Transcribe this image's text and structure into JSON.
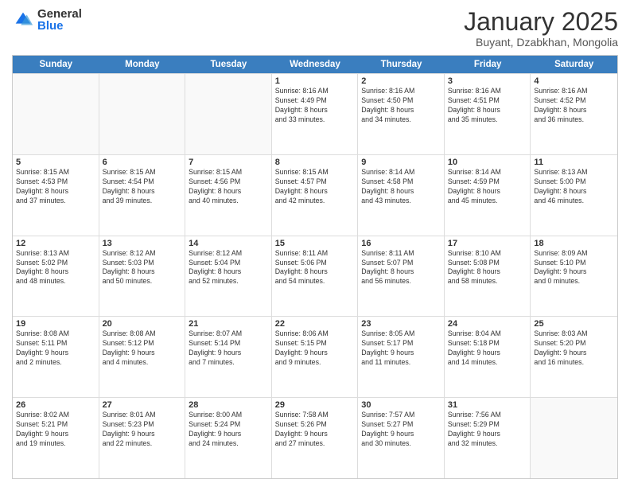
{
  "logo": {
    "general": "General",
    "blue": "Blue"
  },
  "header": {
    "month": "January 2025",
    "location": "Buyant, Dzabkhan, Mongolia"
  },
  "weekdays": [
    "Sunday",
    "Monday",
    "Tuesday",
    "Wednesday",
    "Thursday",
    "Friday",
    "Saturday"
  ],
  "rows": [
    [
      {
        "day": "",
        "text": ""
      },
      {
        "day": "",
        "text": ""
      },
      {
        "day": "",
        "text": ""
      },
      {
        "day": "1",
        "text": "Sunrise: 8:16 AM\nSunset: 4:49 PM\nDaylight: 8 hours\nand 33 minutes."
      },
      {
        "day": "2",
        "text": "Sunrise: 8:16 AM\nSunset: 4:50 PM\nDaylight: 8 hours\nand 34 minutes."
      },
      {
        "day": "3",
        "text": "Sunrise: 8:16 AM\nSunset: 4:51 PM\nDaylight: 8 hours\nand 35 minutes."
      },
      {
        "day": "4",
        "text": "Sunrise: 8:16 AM\nSunset: 4:52 PM\nDaylight: 8 hours\nand 36 minutes."
      }
    ],
    [
      {
        "day": "5",
        "text": "Sunrise: 8:15 AM\nSunset: 4:53 PM\nDaylight: 8 hours\nand 37 minutes."
      },
      {
        "day": "6",
        "text": "Sunrise: 8:15 AM\nSunset: 4:54 PM\nDaylight: 8 hours\nand 39 minutes."
      },
      {
        "day": "7",
        "text": "Sunrise: 8:15 AM\nSunset: 4:56 PM\nDaylight: 8 hours\nand 40 minutes."
      },
      {
        "day": "8",
        "text": "Sunrise: 8:15 AM\nSunset: 4:57 PM\nDaylight: 8 hours\nand 42 minutes."
      },
      {
        "day": "9",
        "text": "Sunrise: 8:14 AM\nSunset: 4:58 PM\nDaylight: 8 hours\nand 43 minutes."
      },
      {
        "day": "10",
        "text": "Sunrise: 8:14 AM\nSunset: 4:59 PM\nDaylight: 8 hours\nand 45 minutes."
      },
      {
        "day": "11",
        "text": "Sunrise: 8:13 AM\nSunset: 5:00 PM\nDaylight: 8 hours\nand 46 minutes."
      }
    ],
    [
      {
        "day": "12",
        "text": "Sunrise: 8:13 AM\nSunset: 5:02 PM\nDaylight: 8 hours\nand 48 minutes."
      },
      {
        "day": "13",
        "text": "Sunrise: 8:12 AM\nSunset: 5:03 PM\nDaylight: 8 hours\nand 50 minutes."
      },
      {
        "day": "14",
        "text": "Sunrise: 8:12 AM\nSunset: 5:04 PM\nDaylight: 8 hours\nand 52 minutes."
      },
      {
        "day": "15",
        "text": "Sunrise: 8:11 AM\nSunset: 5:06 PM\nDaylight: 8 hours\nand 54 minutes."
      },
      {
        "day": "16",
        "text": "Sunrise: 8:11 AM\nSunset: 5:07 PM\nDaylight: 8 hours\nand 56 minutes."
      },
      {
        "day": "17",
        "text": "Sunrise: 8:10 AM\nSunset: 5:08 PM\nDaylight: 8 hours\nand 58 minutes."
      },
      {
        "day": "18",
        "text": "Sunrise: 8:09 AM\nSunset: 5:10 PM\nDaylight: 9 hours\nand 0 minutes."
      }
    ],
    [
      {
        "day": "19",
        "text": "Sunrise: 8:08 AM\nSunset: 5:11 PM\nDaylight: 9 hours\nand 2 minutes."
      },
      {
        "day": "20",
        "text": "Sunrise: 8:08 AM\nSunset: 5:12 PM\nDaylight: 9 hours\nand 4 minutes."
      },
      {
        "day": "21",
        "text": "Sunrise: 8:07 AM\nSunset: 5:14 PM\nDaylight: 9 hours\nand 7 minutes."
      },
      {
        "day": "22",
        "text": "Sunrise: 8:06 AM\nSunset: 5:15 PM\nDaylight: 9 hours\nand 9 minutes."
      },
      {
        "day": "23",
        "text": "Sunrise: 8:05 AM\nSunset: 5:17 PM\nDaylight: 9 hours\nand 11 minutes."
      },
      {
        "day": "24",
        "text": "Sunrise: 8:04 AM\nSunset: 5:18 PM\nDaylight: 9 hours\nand 14 minutes."
      },
      {
        "day": "25",
        "text": "Sunrise: 8:03 AM\nSunset: 5:20 PM\nDaylight: 9 hours\nand 16 minutes."
      }
    ],
    [
      {
        "day": "26",
        "text": "Sunrise: 8:02 AM\nSunset: 5:21 PM\nDaylight: 9 hours\nand 19 minutes."
      },
      {
        "day": "27",
        "text": "Sunrise: 8:01 AM\nSunset: 5:23 PM\nDaylight: 9 hours\nand 22 minutes."
      },
      {
        "day": "28",
        "text": "Sunrise: 8:00 AM\nSunset: 5:24 PM\nDaylight: 9 hours\nand 24 minutes."
      },
      {
        "day": "29",
        "text": "Sunrise: 7:58 AM\nSunset: 5:26 PM\nDaylight: 9 hours\nand 27 minutes."
      },
      {
        "day": "30",
        "text": "Sunrise: 7:57 AM\nSunset: 5:27 PM\nDaylight: 9 hours\nand 30 minutes."
      },
      {
        "day": "31",
        "text": "Sunrise: 7:56 AM\nSunset: 5:29 PM\nDaylight: 9 hours\nand 32 minutes."
      },
      {
        "day": "",
        "text": ""
      }
    ]
  ]
}
